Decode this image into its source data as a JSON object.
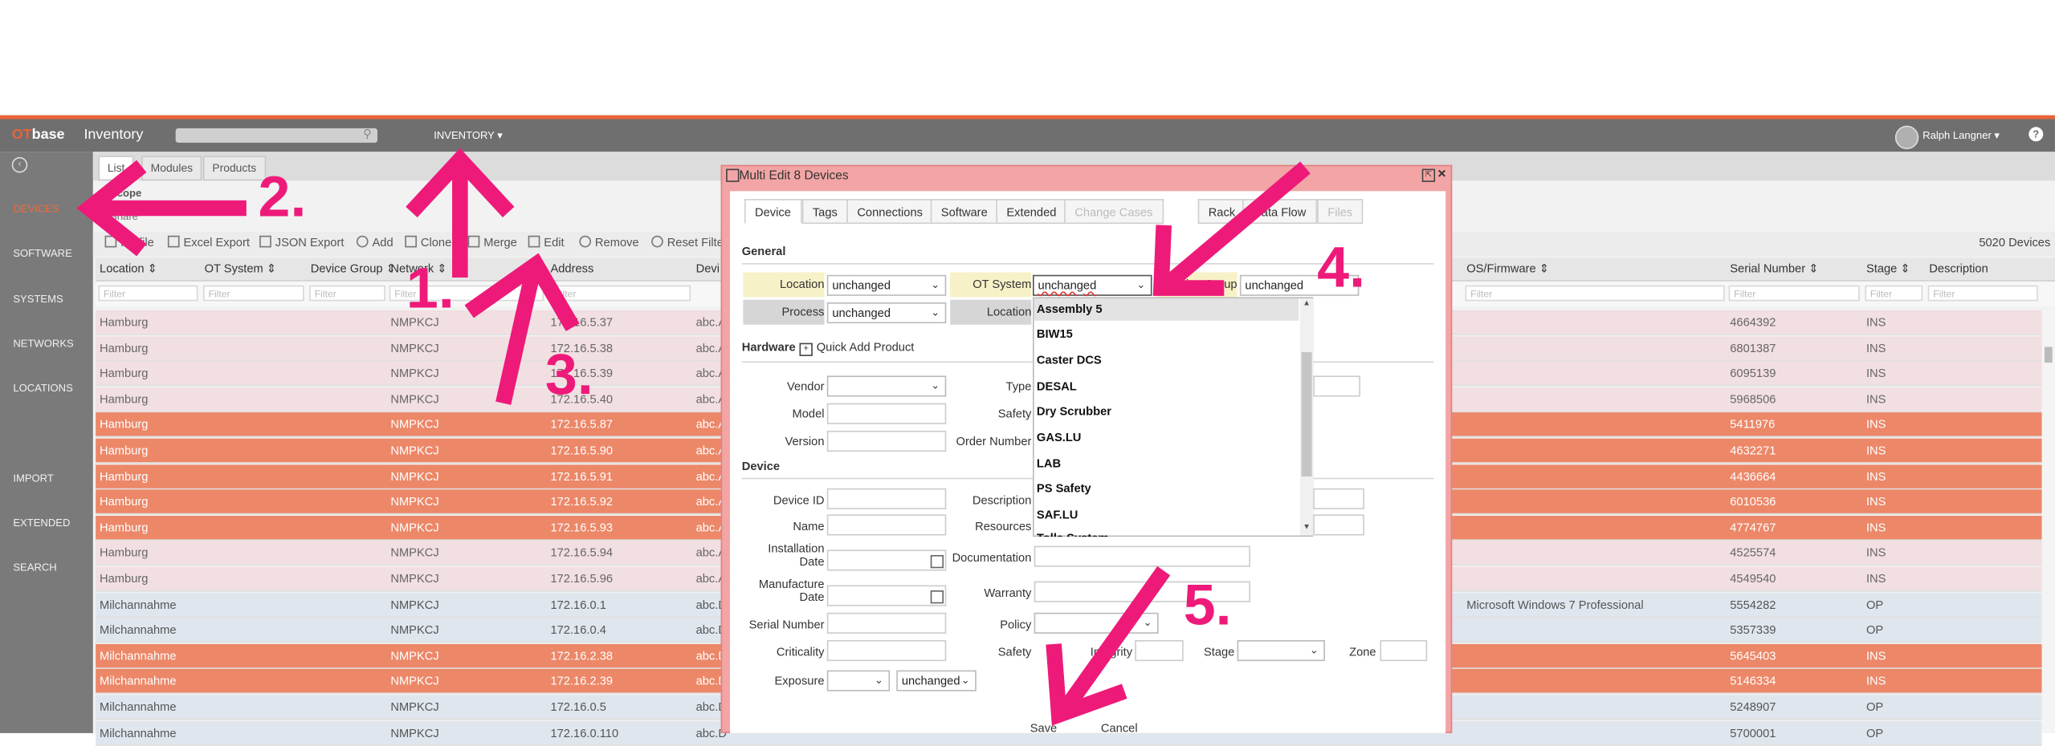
{
  "topbar": {
    "brand_ot": "OT",
    "brand_base": "base",
    "app_title": "Inventory",
    "inventory_menu": "INVENTORY ▾",
    "user_name": "Ralph Langner ▾",
    "help": "?"
  },
  "sidebar": {
    "items": [
      "DEVICES",
      "SOFTWARE",
      "SYSTEMS",
      "NETWORKS",
      "LOCATIONS",
      "IMPORT",
      "EXTENDED",
      "SEARCH"
    ]
  },
  "main": {
    "tabs": [
      "List",
      "Modules",
      "Products"
    ],
    "scope": "Scope",
    "share": "Share",
    "toolbar": [
      "Profile",
      "Excel Export",
      "JSON Export",
      "Add",
      "Clone",
      "Merge",
      "Edit",
      "Remove",
      "Reset Filter"
    ],
    "device_count": "5020 Devices",
    "columns": [
      "Location ⇕",
      "OT System ⇕",
      "Device Group ⇕",
      "Network ⇕",
      "Address",
      "Devi",
      "OS/Firmware ⇕",
      "Serial Number ⇕",
      "Stage ⇕",
      "Description"
    ],
    "filter_placeholder": "Filter",
    "rows": [
      {
        "location": "Hamburg",
        "network": "NMPKCJ",
        "address": "172.16.5.37",
        "dev": "abc.A",
        "os": "",
        "serial": "4664392",
        "stage": "INS",
        "style": "pink"
      },
      {
        "location": "Hamburg",
        "network": "NMPKCJ",
        "address": "172.16.5.38",
        "dev": "abc.A",
        "os": "",
        "serial": "6801387",
        "stage": "INS",
        "style": "pink"
      },
      {
        "location": "Hamburg",
        "network": "NMPKCJ",
        "address": "172.16.5.39",
        "dev": "abc.A",
        "os": "",
        "serial": "6095139",
        "stage": "INS",
        "style": "pink"
      },
      {
        "location": "Hamburg",
        "network": "NMPKCJ",
        "address": "172.16.5.40",
        "dev": "abc.A",
        "os": "",
        "serial": "5968506",
        "stage": "INS",
        "style": "pink"
      },
      {
        "location": "Hamburg",
        "network": "NMPKCJ",
        "address": "172.16.5.87",
        "dev": "abc.A",
        "os": "",
        "serial": "5411976",
        "stage": "INS",
        "style": "orange"
      },
      {
        "location": "Hamburg",
        "network": "NMPKCJ",
        "address": "172.16.5.90",
        "dev": "abc.A",
        "os": "",
        "serial": "4632271",
        "stage": "INS",
        "style": "orange"
      },
      {
        "location": "Hamburg",
        "network": "NMPKCJ",
        "address": "172.16.5.91",
        "dev": "abc.A",
        "os": "",
        "serial": "4436664",
        "stage": "INS",
        "style": "orange"
      },
      {
        "location": "Hamburg",
        "network": "NMPKCJ",
        "address": "172.16.5.92",
        "dev": "abc.A",
        "os": "",
        "serial": "6010536",
        "stage": "INS",
        "style": "orange"
      },
      {
        "location": "Hamburg",
        "network": "NMPKCJ",
        "address": "172.16.5.93",
        "dev": "abc.A",
        "os": "",
        "serial": "4774767",
        "stage": "INS",
        "style": "orange"
      },
      {
        "location": "Hamburg",
        "network": "NMPKCJ",
        "address": "172.16.5.94",
        "dev": "abc.A",
        "os": "",
        "serial": "4525574",
        "stage": "INS",
        "style": "pink"
      },
      {
        "location": "Hamburg",
        "network": "NMPKCJ",
        "address": "172.16.5.96",
        "dev": "abc.A",
        "os": "",
        "serial": "4549540",
        "stage": "INS",
        "style": "pink"
      },
      {
        "location": "Milchannahme",
        "network": "NMPKCJ",
        "address": "172.16.0.1",
        "dev": "abc.D",
        "os": "Microsoft Windows 7 Professional",
        "serial": "5554282",
        "stage": "OP",
        "style": "blue"
      },
      {
        "location": "Milchannahme",
        "network": "NMPKCJ",
        "address": "172.16.0.4",
        "dev": "abc.D",
        "os": "",
        "serial": "5357339",
        "stage": "OP",
        "style": "blue"
      },
      {
        "location": "Milchannahme",
        "network": "NMPKCJ",
        "address": "172.16.2.38",
        "dev": "abc.D",
        "os": "",
        "serial": "5645403",
        "stage": "INS",
        "style": "orange"
      },
      {
        "location": "Milchannahme",
        "network": "NMPKCJ",
        "address": "172.16.2.39",
        "dev": "abc.D",
        "os": "",
        "serial": "5146334",
        "stage": "INS",
        "style": "orange"
      },
      {
        "location": "Milchannahme",
        "network": "NMPKCJ",
        "address": "172.16.0.5",
        "dev": "abc.D",
        "os": "",
        "serial": "5248907",
        "stage": "OP",
        "style": "blue"
      },
      {
        "location": "Milchannahme",
        "network": "NMPKCJ",
        "address": "172.16.0.110",
        "dev": "abc.D",
        "os": "",
        "serial": "5700001",
        "stage": "OP",
        "style": "blue"
      }
    ]
  },
  "modal": {
    "title": "Multi Edit 8 Devices",
    "tabs": [
      "Device",
      "Tags",
      "Connections",
      "Software",
      "Extended",
      "Change Cases",
      "Rack",
      "Data Flow",
      "Files"
    ],
    "general_title": "General",
    "location_label": "Location",
    "location_value": "unchanged",
    "ot_system_label": "OT System",
    "ot_system_value": "unchanged",
    "device_group_label": "Device Group",
    "device_group_value": "unchanged",
    "process_label": "Process",
    "process_value": "unchanged",
    "location2_label": "Location",
    "hardware_title": "Hardware",
    "quick_add_product": "Quick Add Product",
    "vendor_label": "Vendor",
    "model_label": "Model",
    "version_label": "Version",
    "type_label": "Type",
    "safety_label": "Safety",
    "order_number_label": "Order Number",
    "device_title": "Device",
    "device_id_label": "Device ID",
    "name_label": "Name",
    "installation_date_label": "Installation\nDate",
    "manufacture_date_label": "Manufacture\nDate",
    "serial_number_label": "Serial Number",
    "criticality_label": "Criticality",
    "exposure_label": "Exposure",
    "exposure_value": "unchanged",
    "description_label": "Description",
    "resources_label": "Resources",
    "documentation_label": "Documentation",
    "warranty_label": "Warranty",
    "policy_label": "Policy",
    "safety2_label": "Safety",
    "integrity_label": "Integrity",
    "stage_label": "Stage",
    "zone_label": "Zone",
    "save_label": "Save",
    "cancel_label": "Cancel",
    "ot_system_options": [
      "Assembly 5",
      "BIW15",
      "Caster DCS",
      "DESAL",
      "Dry Scrubber",
      "GAS.LU",
      "LAB",
      "PS Safety",
      "SAF.LU",
      "Tolle System"
    ]
  },
  "annotations": {
    "labels": [
      "1.",
      "2.",
      "3.",
      "4.",
      "5."
    ],
    "color": "#ee1a7a"
  },
  "colors": {
    "accent": "#e8643a",
    "row_selected": "#ec8768",
    "row_hamburg": "#f2dfe1",
    "row_milchannahme": "#dfe6ee",
    "modal_frame": "#f3a5a5"
  }
}
